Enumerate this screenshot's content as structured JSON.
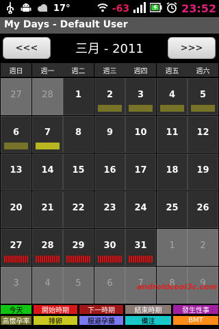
{
  "status": {
    "temperature": "17°",
    "signal_value": "-63",
    "time": "23:52"
  },
  "app": {
    "title": "My Days - Default User"
  },
  "nav": {
    "prev_label": "<<<",
    "next_label": ">>>",
    "month_label": "三月 - 2011"
  },
  "weekdays": [
    "週日",
    "週一",
    "週二",
    "週三",
    "週四",
    "週五",
    "週六"
  ],
  "weeks": [
    [
      {
        "d": "27",
        "other": true
      },
      {
        "d": "28",
        "other": true
      },
      {
        "d": "1"
      },
      {
        "d": "2",
        "mark": "ovulation"
      },
      {
        "d": "3",
        "mark": "ovulation"
      },
      {
        "d": "4",
        "mark": "ovulation"
      },
      {
        "d": "5",
        "mark": "ovulation"
      }
    ],
    [
      {
        "d": "6",
        "mark": "ovulation"
      },
      {
        "d": "7",
        "mark": "ovulation-day"
      },
      {
        "d": "8"
      },
      {
        "d": "9"
      },
      {
        "d": "10"
      },
      {
        "d": "11"
      },
      {
        "d": "12"
      }
    ],
    [
      {
        "d": "13"
      },
      {
        "d": "14"
      },
      {
        "d": "15"
      },
      {
        "d": "16"
      },
      {
        "d": "17"
      },
      {
        "d": "18"
      },
      {
        "d": "19"
      }
    ],
    [
      {
        "d": "20"
      },
      {
        "d": "21"
      },
      {
        "d": "22"
      },
      {
        "d": "23"
      },
      {
        "d": "24"
      },
      {
        "d": "25"
      },
      {
        "d": "26"
      }
    ],
    [
      {
        "d": "27",
        "mark": "period"
      },
      {
        "d": "28",
        "mark": "period"
      },
      {
        "d": "29",
        "mark": "period"
      },
      {
        "d": "30",
        "mark": "period"
      },
      {
        "d": "31",
        "mark": "period"
      },
      {
        "d": "1",
        "other": true
      },
      {
        "d": "2",
        "other": true
      }
    ],
    [
      {
        "d": "3",
        "other": true
      },
      {
        "d": "4",
        "other": true
      },
      {
        "d": "5",
        "other": true
      },
      {
        "d": "6",
        "other": true
      },
      {
        "d": "7",
        "other": true
      },
      {
        "d": "8",
        "other": true
      },
      {
        "d": "9",
        "other": true
      }
    ]
  ],
  "watermark": "androidcool3c.com",
  "legend_row1": [
    {
      "label": "今天",
      "bg": "#11c611",
      "fg": "#000000"
    },
    {
      "label": "開始時期",
      "bg": "#d81818",
      "fg": "#ffffff"
    },
    {
      "label": "下一時期",
      "bg": "#a01818",
      "fg": "#ffffff"
    },
    {
      "label": "結束時期",
      "bg": "#8a7a76",
      "fg": "#ffffff"
    },
    {
      "label": "發生性事",
      "bg": "#a020a0",
      "fg": "#ffffff"
    }
  ],
  "legend_row2": [
    {
      "label": "高懷孕率",
      "bg": "#707028",
      "fg": "#ffffff"
    },
    {
      "label": "排卵",
      "bg": "#c8c820",
      "fg": "#000000"
    },
    {
      "label": "服避孕藥",
      "bg": "#7a7af0",
      "fg": "#000000"
    },
    {
      "label": "備注",
      "bg": "#18c8c8",
      "fg": "#000000"
    },
    {
      "label": "BMT",
      "bg": "#ff8c18",
      "fg": "#ffffff"
    }
  ]
}
